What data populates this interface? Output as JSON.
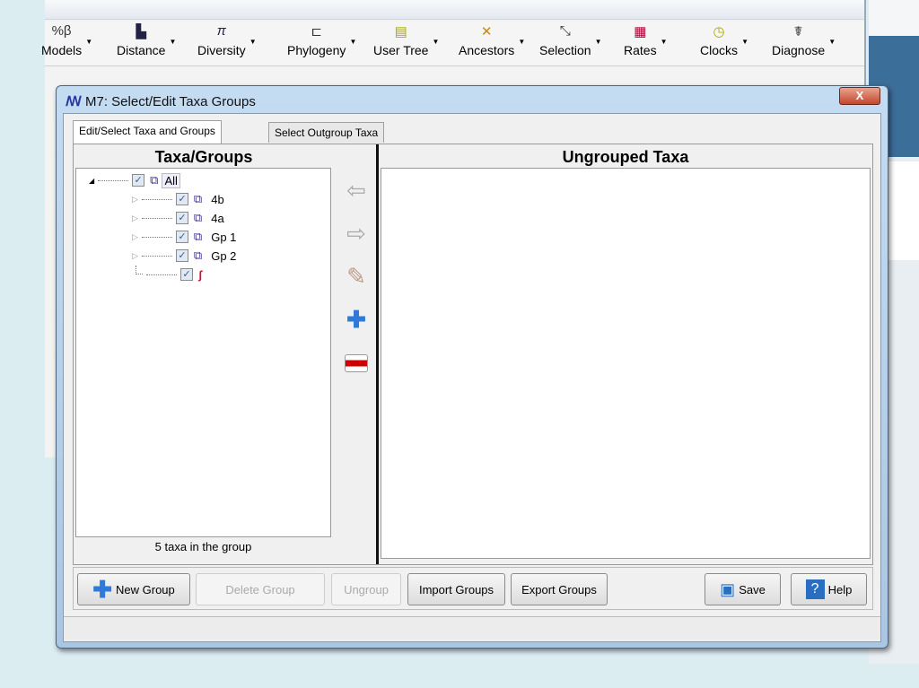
{
  "app_toolbar": {
    "items": [
      {
        "label": "Models",
        "icon": "models-icon"
      },
      {
        "label": "Distance",
        "icon": "distance-icon"
      },
      {
        "label": "Diversity",
        "icon": "pi-icon"
      },
      {
        "label": "Phylogeny",
        "icon": "tree-icon"
      },
      {
        "label": "User Tree",
        "icon": "user-tree-icon"
      },
      {
        "label": "Ancestors",
        "icon": "ancestors-icon"
      },
      {
        "label": "Selection",
        "icon": "selection-icon"
      },
      {
        "label": "Rates",
        "icon": "rates-icon"
      },
      {
        "label": "Clocks",
        "icon": "clock-icon"
      },
      {
        "label": "Diagnose",
        "icon": "caduceus-icon"
      }
    ]
  },
  "dialog": {
    "title": "M7: Select/Edit Taxa Groups",
    "close": "X",
    "tabs": [
      {
        "label": "Edit/Select Taxa and Groups",
        "active": true
      },
      {
        "label": "Select Outgroup Taxa",
        "active": false
      }
    ],
    "left_header": "Taxa/Groups",
    "right_header": "Ungrouped Taxa",
    "tree": [
      {
        "label": "All",
        "checked": true,
        "level": 0
      },
      {
        "label": "4b",
        "checked": true,
        "level": 1
      },
      {
        "label": "4a",
        "checked": true,
        "level": 1
      },
      {
        "label": "Gp 1",
        "checked": true,
        "level": 1
      },
      {
        "label": "Gp 2",
        "checked": true,
        "level": 1
      },
      {
        "label": "",
        "checked": true,
        "level": 1
      }
    ],
    "count_text": "5 taxa in the group",
    "buttons": {
      "new_group": "New Group",
      "delete_group": "Delete Group",
      "ungroup": "Ungroup",
      "import_groups": "Import Groups",
      "export_groups": "Export Groups",
      "save": "Save",
      "help": "Help"
    }
  },
  "colors": {
    "background": "#dcedf2",
    "dialog_frame": "#a9c6e4",
    "close": "#c2462d"
  }
}
